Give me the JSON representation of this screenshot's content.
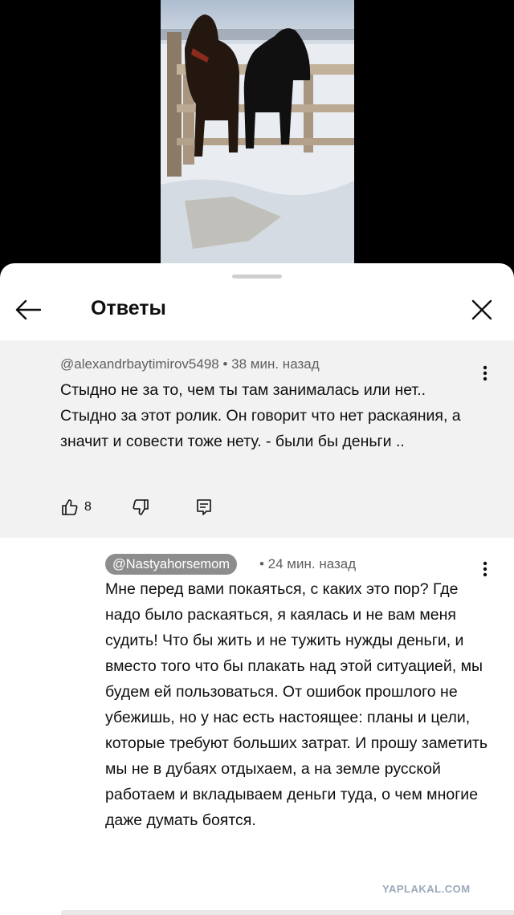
{
  "sheet": {
    "title": "Ответы"
  },
  "parent_comment": {
    "author": "@alexandrbaytimirov5498",
    "time": "• 38 мин. назад",
    "text": "Стыдно не за то, чем ты там занималась или нет.. Стыдно за этот ролик. Он говорит что нет раскаяния, а значит и совести тоже нету. - были бы деньги ..",
    "likes": "8"
  },
  "reply_comment": {
    "author": "@Nastyahorsemom",
    "time": "• 24 мин. назад",
    "text": "Мне перед вами покаяться, с каких это пор? Где надо было раскаяться, я каялась и не вам меня судить! Что бы жить и не тужить нужды деньги, и вместо того что бы плакать над этой ситуацией, мы будем ей пользоваться. От ошибок прошлого не убежишь, но у нас есть настоящее: планы и цели, которые требуют больших затрат. И прошу заметить мы не в дубаях отдыхаем, а на земле русской работаем и вкладываем деньги туда, о чем многие даже думать боятся."
  },
  "watermark": "YAPLAKAL.COM",
  "icons": [
    "back-arrow-icon",
    "close-icon",
    "more-vert-icon",
    "thumb-up-icon",
    "thumb-down-icon",
    "reply-icon"
  ],
  "colors": {
    "parent_bg": "#f2f2f2",
    "chip_bg": "#8d8d8d",
    "meta_text": "#606060"
  }
}
